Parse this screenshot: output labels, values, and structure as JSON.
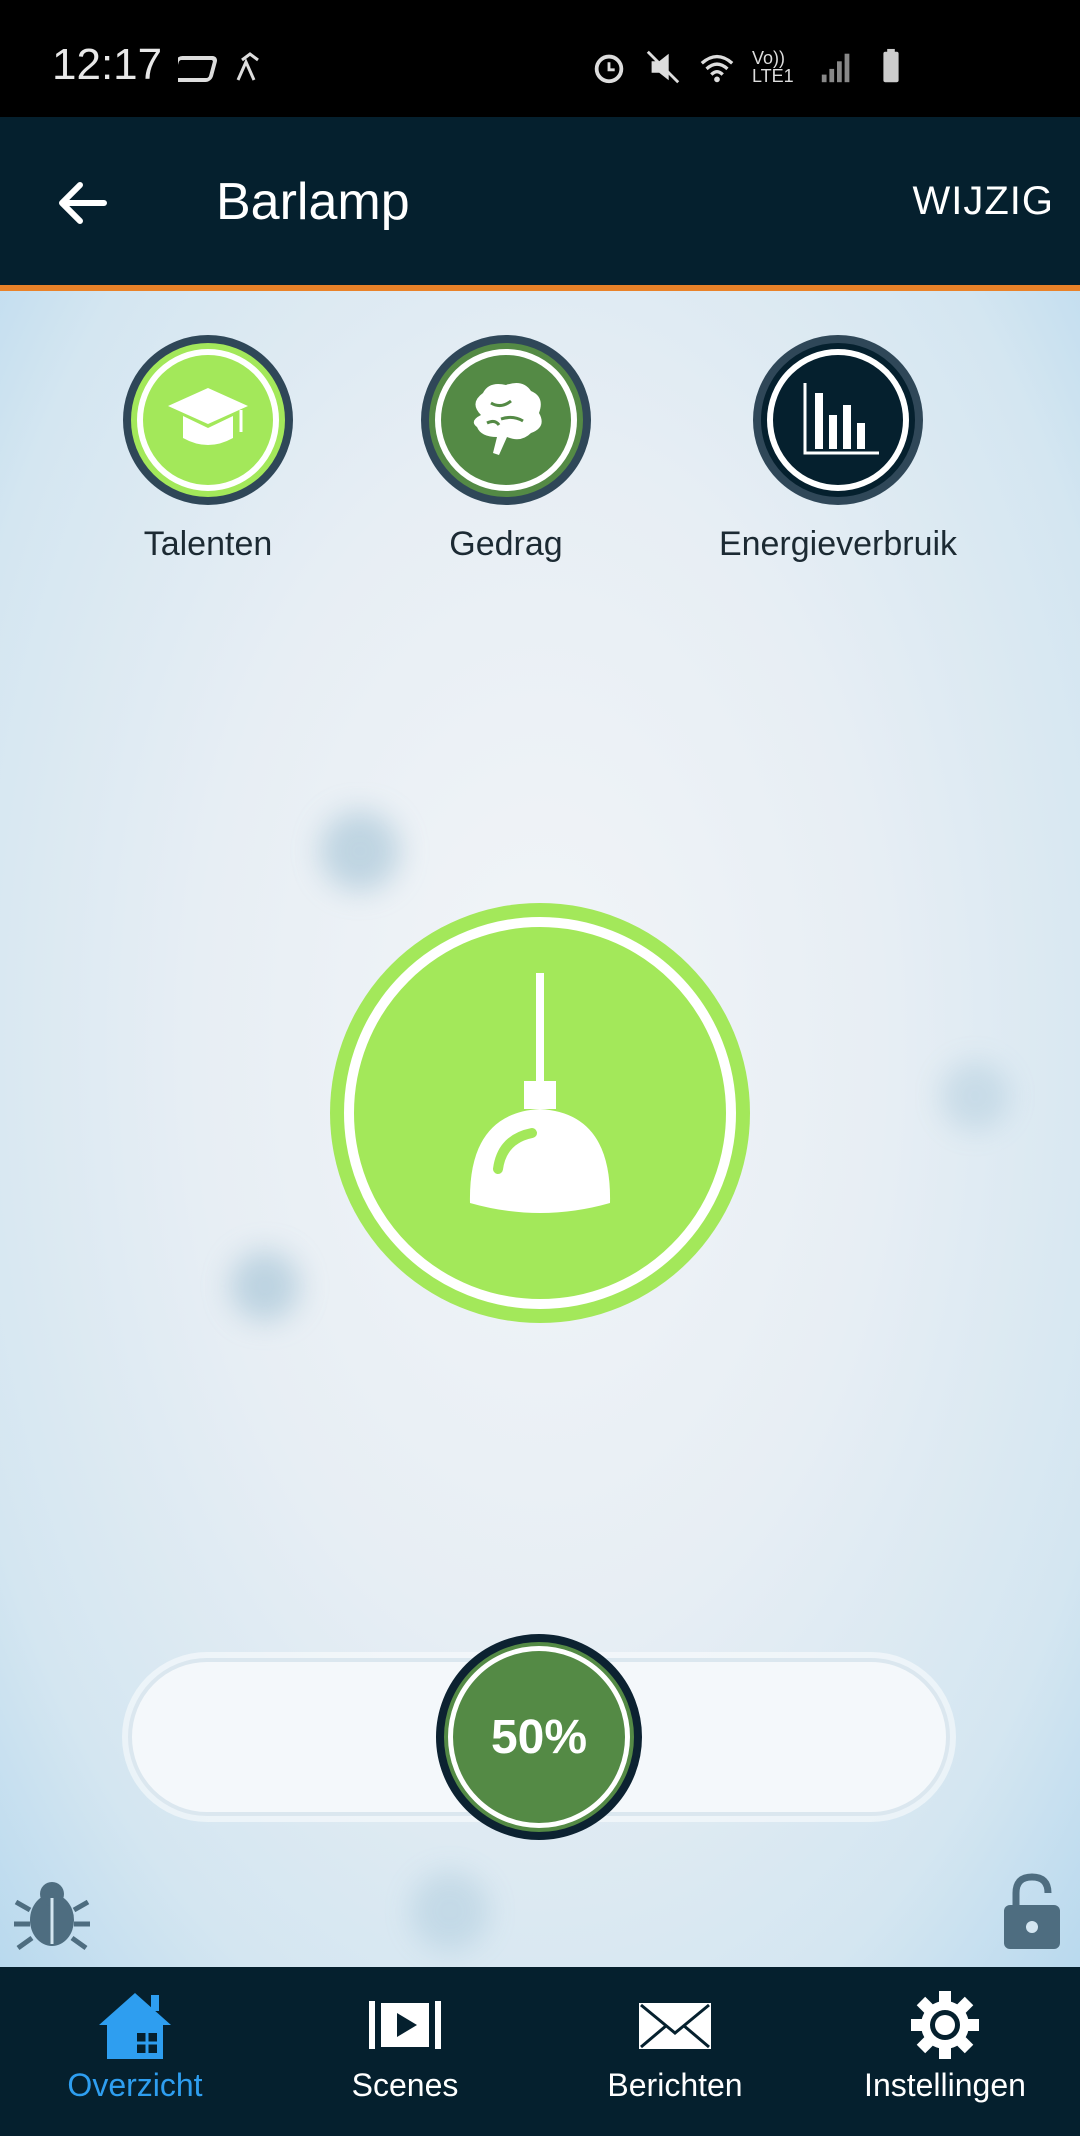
{
  "status_bar": {
    "time": "12:17",
    "icons": [
      "app-icon",
      "cloud-icon",
      "alarm-icon",
      "mute-icon",
      "wifi-icon",
      "lte-icon",
      "signal-icon",
      "battery-icon"
    ],
    "lte_text": "Vo)) LTE1"
  },
  "app_bar": {
    "title": "Barlamp",
    "edit_label": "WIJZIG"
  },
  "features": [
    {
      "label": "Talenten",
      "icon": "graduation-cap-icon",
      "color": "#a3e85a"
    },
    {
      "label": "Gedrag",
      "icon": "brain-icon",
      "color": "#548a45"
    },
    {
      "label": "Energieverbruik",
      "icon": "bar-chart-icon",
      "color": "#05202e"
    }
  ],
  "device": {
    "icon": "pendant-lamp-icon",
    "state_color": "#a3e85a"
  },
  "dimmer": {
    "value_label": "50%",
    "value": 50
  },
  "bottom_nav": {
    "items": [
      {
        "label": "Overzicht",
        "icon": "home-icon",
        "active": true
      },
      {
        "label": "Scenes",
        "icon": "scenes-icon",
        "active": false
      },
      {
        "label": "Berichten",
        "icon": "mail-icon",
        "active": false
      },
      {
        "label": "Instellingen",
        "icon": "gear-icon",
        "active": false
      }
    ]
  },
  "colors": {
    "accent": "#e98229",
    "active_nav": "#2e9ef0",
    "dark": "#05202e"
  }
}
